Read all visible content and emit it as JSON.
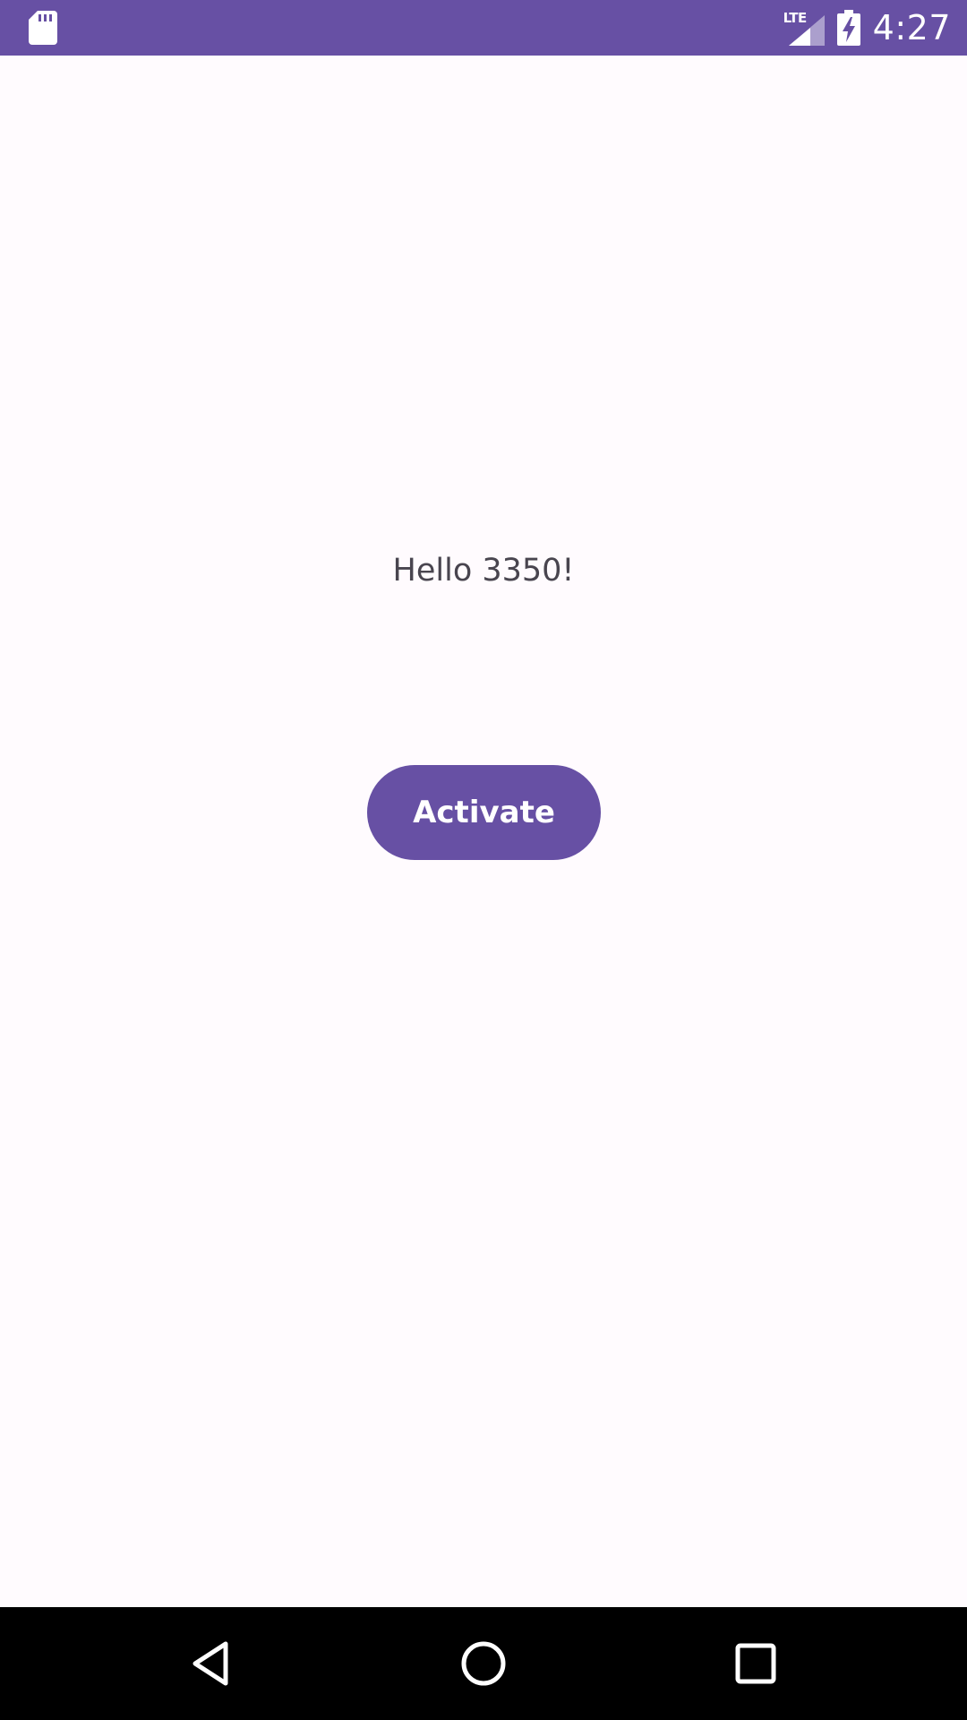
{
  "status_bar": {
    "background_color": "#6750a4",
    "left_icons": [
      "sd-card-icon"
    ],
    "network_label": "LTE",
    "right_icons": [
      "signal-icon",
      "battery-charging-icon"
    ],
    "time": "4:27"
  },
  "main": {
    "greeting": "Hello 3350!",
    "activate_button_label": "Activate",
    "button_color": "#6750a4"
  },
  "nav_bar": {
    "buttons": [
      "back-icon",
      "home-icon",
      "recents-icon"
    ]
  }
}
